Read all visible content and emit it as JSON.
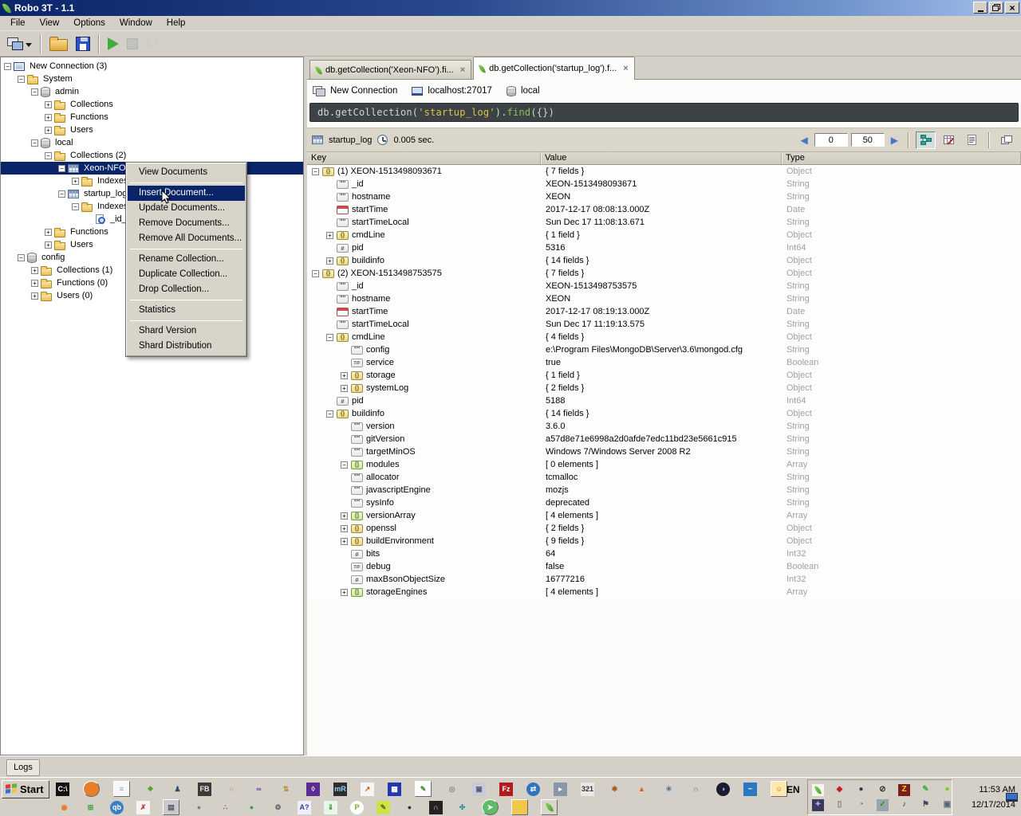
{
  "window": {
    "title": "Robo 3T - 1.1"
  },
  "menu": {
    "items": [
      "File",
      "View",
      "Options",
      "Window",
      "Help"
    ]
  },
  "toolbar": {
    "buttons": [
      {
        "n": "connections-menu",
        "type": "connect",
        "dd": true
      },
      {
        "type": "sep"
      },
      {
        "n": "open-file",
        "type": "folder"
      },
      {
        "n": "save-file",
        "type": "floppy"
      },
      {
        "type": "sep"
      },
      {
        "n": "execute-query",
        "type": "play"
      },
      {
        "n": "stop-query",
        "type": "stop",
        "disabled": true
      },
      {
        "n": "change-orientation",
        "type": "gears",
        "disabled": true
      }
    ]
  },
  "tree": {
    "items": [
      {
        "label": "New Connection (3)",
        "level": 0,
        "exp": "m",
        "icon": "computer"
      },
      {
        "label": "System",
        "level": 1,
        "exp": "m",
        "icon": "folder"
      },
      {
        "label": "admin",
        "level": 2,
        "exp": "m",
        "icon": "db"
      },
      {
        "label": "Collections",
        "level": 3,
        "exp": "p",
        "icon": "folder"
      },
      {
        "label": "Functions",
        "level": 3,
        "exp": "p",
        "icon": "folder"
      },
      {
        "label": "Users",
        "level": 3,
        "exp": "p",
        "icon": "folder"
      },
      {
        "label": "local",
        "level": 2,
        "exp": "m",
        "icon": "db"
      },
      {
        "label": "Collections (2)",
        "level": 3,
        "exp": "m",
        "icon": "folder"
      },
      {
        "label": "Xeon-NFO",
        "level": 4,
        "exp": "m",
        "icon": "table",
        "selected": true
      },
      {
        "label": "Indexes",
        "level": 5,
        "exp": "p",
        "icon": "folder"
      },
      {
        "label": "startup_log",
        "level": 4,
        "exp": "m",
        "icon": "table"
      },
      {
        "label": "Indexes",
        "level": 5,
        "exp": "m",
        "icon": "folder"
      },
      {
        "label": "_id_",
        "level": 6,
        "exp": "",
        "icon": "index"
      },
      {
        "label": "Functions",
        "level": 3,
        "exp": "p",
        "icon": "folder"
      },
      {
        "label": "Users",
        "level": 3,
        "exp": "p",
        "icon": "folder"
      },
      {
        "label": "config",
        "level": 1,
        "exp": "m",
        "icon": "db"
      },
      {
        "label": "Collections (1)",
        "level": 2,
        "exp": "p",
        "icon": "folder"
      },
      {
        "label": "Functions (0)",
        "level": 2,
        "exp": "p",
        "icon": "folder"
      },
      {
        "label": "Users (0)",
        "level": 2,
        "exp": "p",
        "icon": "folder"
      }
    ]
  },
  "context_menu": {
    "items": [
      {
        "type": "item",
        "label": "View Documents"
      },
      {
        "type": "separator"
      },
      {
        "type": "item",
        "label": "Insert Document...",
        "highlighted": true
      },
      {
        "type": "item",
        "label": "Update Documents..."
      },
      {
        "type": "item",
        "label": "Remove Documents..."
      },
      {
        "type": "item",
        "label": "Remove All Documents..."
      },
      {
        "type": "separator"
      },
      {
        "type": "item",
        "label": "Rename Collection..."
      },
      {
        "type": "item",
        "label": "Duplicate Collection..."
      },
      {
        "type": "item",
        "label": "Drop Collection..."
      },
      {
        "type": "separator"
      },
      {
        "type": "item",
        "label": "Statistics"
      },
      {
        "type": "separator"
      },
      {
        "type": "item",
        "label": "Shard Version"
      },
      {
        "type": "item",
        "label": "Shard Distribution"
      }
    ]
  },
  "tabs": [
    {
      "label": "db.getCollection('Xeon-NFO').fi...",
      "active": false
    },
    {
      "label": "db.getCollection('startup_log').f...",
      "active": true
    }
  ],
  "breadcrumb": {
    "connection": "New Connection",
    "server": "localhost:27017",
    "database": "local"
  },
  "query": {
    "segments": [
      {
        "text": "db.getCollection(",
        "color": "#d2d4d5"
      },
      {
        "text": "'startup_log'",
        "color": "#e0c23f"
      },
      {
        "text": ")",
        "color": "#d2d4d5"
      },
      {
        "text": ".",
        "color": "#d2d4d5"
      },
      {
        "text": "find",
        "color": "#8cc152"
      },
      {
        "text": "({})",
        "color": "#d2d4d5"
      }
    ]
  },
  "results_bar": {
    "collection": "startup_log",
    "time": "0.005 sec.",
    "skip": "0",
    "limit": "50"
  },
  "table": {
    "headers": [
      "Key",
      "Value",
      "Type"
    ],
    "rows": [
      {
        "k": "(1) XEON-1513498093671",
        "v": "{ 7 fields }",
        "t": "Object",
        "level": 0,
        "exp": "m",
        "ic": "o"
      },
      {
        "k": "_id",
        "v": "XEON-1513498093671",
        "t": "String",
        "level": 1,
        "exp": "",
        "ic": "s"
      },
      {
        "k": "hostname",
        "v": "XEON",
        "t": "String",
        "level": 1,
        "exp": "",
        "ic": "s"
      },
      {
        "k": "startTime",
        "v": "2017-12-17 08:08:13.000Z",
        "t": "Date",
        "level": 1,
        "exp": "",
        "ic": "d"
      },
      {
        "k": "startTimeLocal",
        "v": "Sun Dec 17 11:08:13.671",
        "t": "String",
        "level": 1,
        "exp": "",
        "ic": "s"
      },
      {
        "k": "cmdLine",
        "v": "{ 1 field }",
        "t": "Object",
        "level": 1,
        "exp": "p",
        "ic": "o"
      },
      {
        "k": "pid",
        "v": "5316",
        "t": "Int64",
        "level": 1,
        "exp": "",
        "ic": "n"
      },
      {
        "k": "buildinfo",
        "v": "{ 14 fields }",
        "t": "Object",
        "level": 1,
        "exp": "p",
        "ic": "o"
      },
      {
        "k": "(2) XEON-1513498753575",
        "v": "{ 7 fields }",
        "t": "Object",
        "level": 0,
        "exp": "m",
        "ic": "o"
      },
      {
        "k": "_id",
        "v": "XEON-1513498753575",
        "t": "String",
        "level": 1,
        "exp": "",
        "ic": "s"
      },
      {
        "k": "hostname",
        "v": "XEON",
        "t": "String",
        "level": 1,
        "exp": "",
        "ic": "s"
      },
      {
        "k": "startTime",
        "v": "2017-12-17 08:19:13.000Z",
        "t": "Date",
        "level": 1,
        "exp": "",
        "ic": "d"
      },
      {
        "k": "startTimeLocal",
        "v": "Sun Dec 17 11:19:13.575",
        "t": "String",
        "level": 1,
        "exp": "",
        "ic": "s"
      },
      {
        "k": "cmdLine",
        "v": "{ 4 fields }",
        "t": "Object",
        "level": 1,
        "exp": "m",
        "ic": "o"
      },
      {
        "k": "config",
        "v": "e:\\Program Files\\MongoDB\\Server\\3.6\\mongod.cfg",
        "t": "String",
        "level": 2,
        "exp": "",
        "ic": "s"
      },
      {
        "k": "service",
        "v": "true",
        "t": "Boolean",
        "level": 2,
        "exp": "",
        "ic": "b"
      },
      {
        "k": "storage",
        "v": "{ 1 field }",
        "t": "Object",
        "level": 2,
        "exp": "p",
        "ic": "o"
      },
      {
        "k": "systemLog",
        "v": "{ 2 fields }",
        "t": "Object",
        "level": 2,
        "exp": "p",
        "ic": "o"
      },
      {
        "k": "pid",
        "v": "5188",
        "t": "Int64",
        "level": 1,
        "exp": "",
        "ic": "n"
      },
      {
        "k": "buildinfo",
        "v": "{ 14 fields }",
        "t": "Object",
        "level": 1,
        "exp": "m",
        "ic": "o"
      },
      {
        "k": "version",
        "v": "3.6.0",
        "t": "String",
        "level": 2,
        "exp": "",
        "ic": "s"
      },
      {
        "k": "gitVersion",
        "v": "a57d8e71e6998a2d0afde7edc11bd23e5661c915",
        "t": "String",
        "level": 2,
        "exp": "",
        "ic": "s"
      },
      {
        "k": "targetMinOS",
        "v": "Windows 7/Windows Server 2008 R2",
        "t": "String",
        "level": 2,
        "exp": "",
        "ic": "s"
      },
      {
        "k": "modules",
        "v": "[ 0 elements ]",
        "t": "Array",
        "level": 2,
        "exp": "m",
        "ic": "a"
      },
      {
        "k": "allocator",
        "v": "tcmalloc",
        "t": "String",
        "level": 2,
        "exp": "",
        "ic": "s"
      },
      {
        "k": "javascriptEngine",
        "v": "mozjs",
        "t": "String",
        "level": 2,
        "exp": "",
        "ic": "s"
      },
      {
        "k": "sysInfo",
        "v": "deprecated",
        "t": "String",
        "level": 2,
        "exp": "",
        "ic": "s"
      },
      {
        "k": "versionArray",
        "v": "[ 4 elements ]",
        "t": "Array",
        "level": 2,
        "exp": "p",
        "ic": "a"
      },
      {
        "k": "openssl",
        "v": "{ 2 fields }",
        "t": "Object",
        "level": 2,
        "exp": "p",
        "ic": "o"
      },
      {
        "k": "buildEnvironment",
        "v": "{ 9 fields }",
        "t": "Object",
        "level": 2,
        "exp": "p",
        "ic": "o"
      },
      {
        "k": "bits",
        "v": "64",
        "t": "Int32",
        "level": 2,
        "exp": "",
        "ic": "n"
      },
      {
        "k": "debug",
        "v": "false",
        "t": "Boolean",
        "level": 2,
        "exp": "",
        "ic": "b"
      },
      {
        "k": "maxBsonObjectSize",
        "v": "16777216",
        "t": "Int32",
        "level": 2,
        "exp": "",
        "ic": "n"
      },
      {
        "k": "storageEngines",
        "v": "[ 4 elements ]",
        "t": "Array",
        "level": 2,
        "exp": "p",
        "ic": "a"
      }
    ]
  },
  "logs_label": "Logs",
  "taskbar": {
    "start_label": "Start",
    "language": "EN",
    "clock": {
      "time": "11:53 AM",
      "date": "12/17/2014"
    },
    "quick_launch_row1": [
      {
        "n": "cmd",
        "g": "C:\\",
        "bg": "#111111",
        "fg": "#ffffff"
      },
      {
        "n": "firefox",
        "g": "",
        "bg": "#e87d2a",
        "r": 1,
        "bx": 1
      },
      {
        "n": "notepad",
        "g": "≡",
        "bg": "#f8f8f8",
        "fg": "#7a9ccc",
        "bx": 1
      },
      {
        "n": "image-viewer",
        "g": "❖",
        "fg": "#55a033"
      },
      {
        "n": "network-admin",
        "g": "♟",
        "fg": "#334d66"
      },
      {
        "n": "flash-builder",
        "g": "FB",
        "bg": "#3b3b3b",
        "fg": "#e8e8e8"
      },
      {
        "n": "db-browser",
        "g": "○",
        "fg": "#b08820"
      },
      {
        "n": "infinity-app",
        "g": "∞",
        "fg": "#6a3fa0"
      },
      {
        "n": "db-export",
        "g": "⇅",
        "fg": "#b08820"
      },
      {
        "n": "visual-studio",
        "g": "◊",
        "bg": "#5c2d91",
        "fg": "#ffffff"
      },
      {
        "n": "mremote",
        "g": "mR",
        "bg": "#2d2d2d",
        "fg": "#8fd0ff"
      },
      {
        "n": "rocket-doc",
        "g": "↗",
        "bg": "#f5f5f5",
        "fg": "#cc5511"
      },
      {
        "n": "backup-floppy",
        "g": "▦",
        "bg": "#2038b0",
        "fg": "#ffffff"
      },
      {
        "n": "notepad2",
        "g": "✎",
        "bg": "#ffffff",
        "fg": "#3f8f3f",
        "bx": 1
      },
      {
        "n": "cd-burner",
        "g": "◎",
        "fg": "#8a8a99"
      },
      {
        "n": "window-folder",
        "g": "▣",
        "bg": "#c8ccd8",
        "fg": "#555f77"
      },
      {
        "n": "filezilla",
        "g": "Fz",
        "bg": "#b01c1c",
        "fg": "#ffffff"
      },
      {
        "n": "sync-globe",
        "g": "⇄",
        "bg": "#2f74bc",
        "fg": "#ffffff",
        "r": 1
      },
      {
        "n": "media-player",
        "g": "▸",
        "bg": "#8a97a8",
        "fg": "#ffffff"
      },
      {
        "n": "video-321",
        "g": "321",
        "bg": "#e8e8e8",
        "fg": "#333333"
      },
      {
        "n": "film-reel",
        "g": "✱",
        "fg": "#aa5522"
      },
      {
        "n": "vlc",
        "g": "▲",
        "fg": "#e8610a"
      },
      {
        "n": "gear-tool",
        "g": "✳",
        "bg": "#d0d0d0",
        "fg": "#666677"
      },
      {
        "n": "headphones",
        "g": "∩",
        "fg": "#2a52a0"
      },
      {
        "n": "eclipse",
        "g": "◑",
        "bg": "#1b1b2e",
        "fg": "#9db8ff",
        "r": 1
      },
      {
        "n": "audio-app",
        "g": "~",
        "bg": "#2b77c0",
        "fg": "#ffffff"
      },
      {
        "n": "smiley-app",
        "g": "☺",
        "bg": "#ffe9b0",
        "fg": "#cc6d1e",
        "bx": 1
      }
    ],
    "quick_launch_row2": [
      {
        "n": "blender",
        "g": "◉",
        "fg": "#e87722"
      },
      {
        "n": "windows-logo",
        "g": "⊞",
        "fg": "#3aa335"
      },
      {
        "n": "quickbooks",
        "g": "qb",
        "bg": "#3a7fc2",
        "fg": "#ffffff",
        "r": 1
      },
      {
        "n": "xml-ribbon",
        "g": "✗",
        "bg": "#f5f5f5",
        "fg": "#c03030"
      },
      {
        "n": "server-manager",
        "g": "▤",
        "bg": "#c9c9c9",
        "fg": "#555566",
        "bx": 1
      },
      {
        "n": "globe-gray",
        "g": "●",
        "fg": "#6a8f7f"
      },
      {
        "n": "color-spheres",
        "g": "∴",
        "fg": "#c04545"
      },
      {
        "n": "globe-green",
        "g": "●",
        "fg": "#3f9d4f"
      },
      {
        "n": "mouse-config",
        "g": "⚙",
        "fg": "#555566"
      },
      {
        "n": "language-tool",
        "g": "A?",
        "bg": "#eeeeff",
        "fg": "#334488"
      },
      {
        "n": "secure-update",
        "g": "⇓",
        "bg": "#e8f5e8",
        "fg": "#2f8f2f"
      },
      {
        "n": "program-p",
        "g": "P",
        "bg": "#ffffff",
        "fg": "#6fae22",
        "r": 1
      },
      {
        "n": "paint-tool",
        "g": "✎",
        "bg": "#cfe24a",
        "fg": "#6a6a12"
      },
      {
        "n": "dark-sphere",
        "g": "●",
        "fg": "#28303f"
      },
      {
        "n": "lock-app",
        "g": "∩",
        "bg": "#222222",
        "fg": "#dddddd"
      },
      {
        "n": "knot-app",
        "g": "✣",
        "fg": "#16808f"
      },
      {
        "n": "vpn-status",
        "g": "➤",
        "bg": "#5fba6a",
        "fg": "#ffffff",
        "r": 1,
        "bx": 1
      },
      {
        "n": "file-explorer",
        "g": "",
        "bg": "#f2c84b",
        "bx": 1
      },
      {
        "n": "robo3t-active",
        "leaf": 1,
        "bx": 1
      }
    ],
    "tray_row1": [
      {
        "n": "robo3t-tray",
        "leaf": 1
      },
      {
        "n": "red-diamond",
        "g": "◆",
        "fg": "#c32222"
      },
      {
        "n": "dark-globe",
        "g": "●",
        "fg": "#2f3d52"
      },
      {
        "n": "no-sign",
        "g": "⊘",
        "fg": "#333333"
      },
      {
        "n": "filezilla-tray",
        "g": "Z",
        "bg": "#7a1f1f",
        "fg": "#ffd200"
      },
      {
        "n": "paint-tray",
        "g": "✎",
        "fg": "#3faa3f"
      },
      {
        "n": "green-status",
        "g": "●",
        "fg": "#7ec832"
      }
    ],
    "tray_row2": [
      {
        "n": "compass",
        "g": "✦",
        "bg": "#3a3a5c",
        "fg": "#b89ae0",
        "r": 1
      },
      {
        "n": "mouse",
        "g": "▯",
        "fg": "#777777"
      },
      {
        "n": "meter",
        "g": "◔",
        "fg": "#666677"
      },
      {
        "n": "usb-safe",
        "g": "✓",
        "bg": "#9aa4ad",
        "fg": "#2f8f2f"
      },
      {
        "n": "volume",
        "g": "♪",
        "fg": "#444444"
      },
      {
        "n": "flag",
        "g": "⚑",
        "fg": "#3a4a66"
      },
      {
        "n": "network",
        "g": "▣",
        "fg": "#556677"
      }
    ]
  },
  "colors": {
    "selection": "#0a246a",
    "titlebar_left": "#0b2569",
    "titlebar_right": "#a6c1ea",
    "query_background": "#3d4246",
    "query_string": "#e0c23f",
    "query_keyword": "#8cc152",
    "type_text": "#9f9f9f",
    "view_active_teal": "#2f9e94",
    "leaf_green": "#4e9e2e"
  }
}
